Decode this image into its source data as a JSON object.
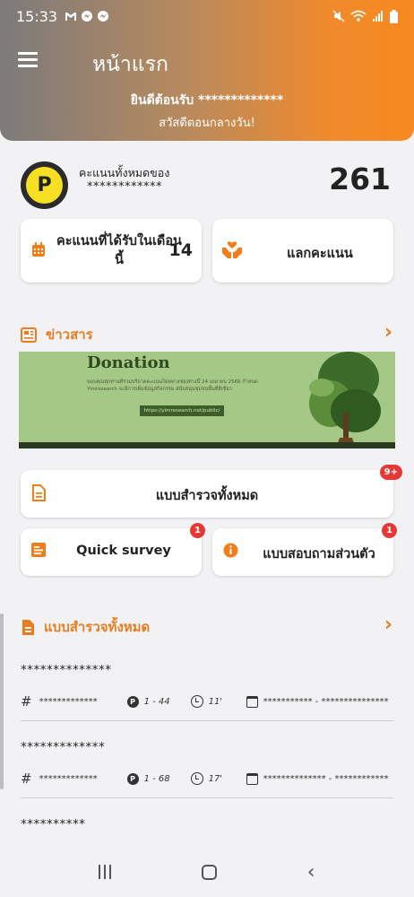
{
  "status_bar": {
    "time": "15:33"
  },
  "header": {
    "title": "หน้าแรก",
    "welcome": "ยินดีต้อนรับ *************",
    "greeting": "สวัสดีตอนกลางวัน!"
  },
  "points": {
    "badge_letter": "P",
    "label": "คะแนนทั้งหมดของ",
    "user": "************",
    "total": "261",
    "month_label": "คะแนนที่ได้รับในเดือนนี้",
    "month_value": "14",
    "redeem_label": "แลกคะแนน"
  },
  "news": {
    "title": "ข่าวสาร",
    "banner_title": "Donation",
    "banner_text": "ขอบคุณทุกท่านที่ร่วมบริจาคคะแนนโดยทางช่องทางนี้ 24 เมษายน 2566 กำหนด Yimresearch จะมีการเพิ่มข้อมูลกิจกรรม สนับสนุนชุมชนพื้นที่สีเขียว",
    "banner_link": "https://yimresearch.net/public/"
  },
  "surveys": {
    "all_label": "แบบสำรวจทั้งหมด",
    "all_badge": "9+",
    "quick_label": "Quick survey",
    "quick_badge": "1",
    "personal_label": "แบบสอบถามส่วนตัว",
    "personal_badge": "1",
    "section_title": "แบบสำรวจทั้งหมด",
    "items": [
      {
        "title": "**************",
        "code": "*************",
        "points": "1 - 44",
        "time": "11'",
        "date": "*********** - ***************"
      },
      {
        "title": "*************",
        "code": "*************",
        "points": "1 - 68",
        "time": "17'",
        "date": "************** - ************"
      },
      {
        "title": "**********"
      }
    ]
  },
  "colors": {
    "accent": "#e77d1f",
    "badge": "#e53935",
    "points_yellow": "#f7e024"
  }
}
